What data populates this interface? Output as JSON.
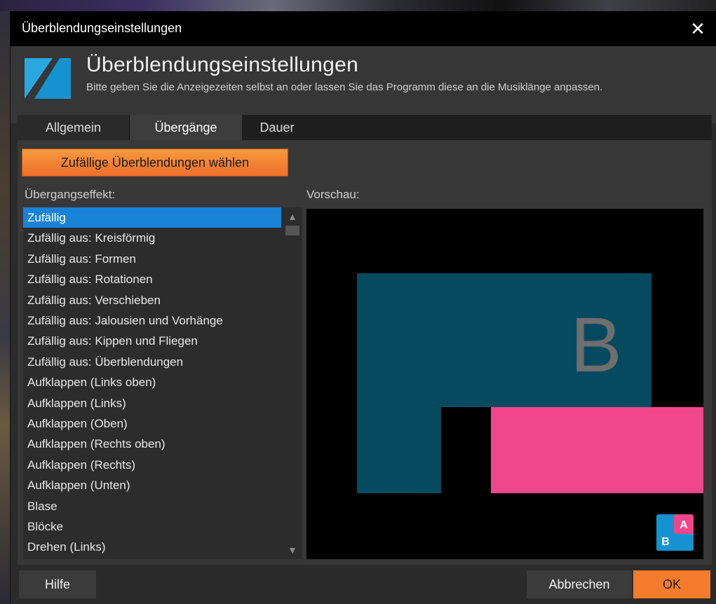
{
  "window": {
    "title": "Überblendungseinstellungen"
  },
  "header": {
    "title": "Überblendungseinstellungen",
    "subtitle": "Bitte geben Sie die Anzeigezeiten selbst an oder lassen Sie das Programm diese an die Musiklänge anpassen."
  },
  "tabs": [
    {
      "label": "Allgemein"
    },
    {
      "label": "Übergänge",
      "active": true
    },
    {
      "label": "Dauer"
    }
  ],
  "random_button": "Zufällige Überblendungen wählen",
  "effect_label": "Übergangseffekt:",
  "preview_label": "Vorschau:",
  "effects": [
    "Zufällig",
    "Zufällig aus: Kreisförmig",
    "Zufällig aus: Formen",
    "Zufällig aus: Rotationen",
    "Zufällig aus: Verschieben",
    "Zufällig aus: Jalousien und Vorhänge",
    "Zufällig aus: Kippen und Fliegen",
    "Zufällig aus: Überblendungen",
    "Aufklappen (Links oben)",
    "Aufklappen (Links)",
    "Aufklappen (Oben)",
    "Aufklappen (Rechts oben)",
    "Aufklappen (Rechts)",
    "Aufklappen (Unten)",
    "Blase",
    "Blöcke",
    "Drehen (Links)"
  ],
  "selected_effect": "Zufällig",
  "preview": {
    "slide_b_letter": "B",
    "badge_a": "A",
    "badge_b": "B",
    "colors": {
      "slide_b": "#064a60",
      "slide_a": "#f0468a",
      "letter": "#6e6e6e",
      "badge_b": "#1593d0"
    }
  },
  "footer": {
    "help": "Hilfe",
    "cancel": "Abbrechen",
    "ok": "OK"
  },
  "icons": {
    "close": "close-icon",
    "scroll_up": "scroll-up-icon",
    "scroll_down": "scroll-down-icon",
    "logo": "transition-logo-icon"
  }
}
